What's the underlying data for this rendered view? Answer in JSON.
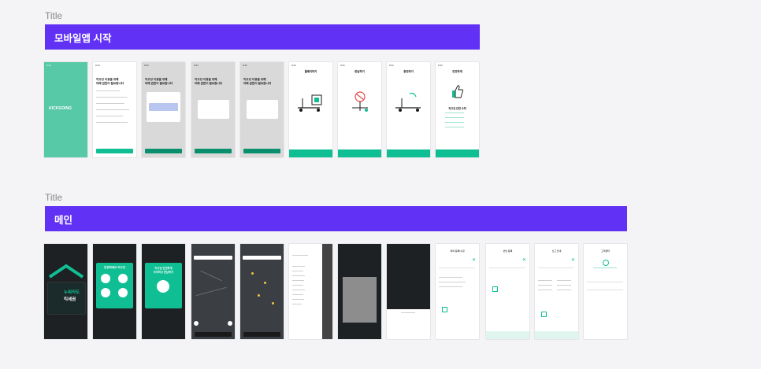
{
  "sections": [
    {
      "title": "Title",
      "banner": "모바일앱 시작"
    },
    {
      "title": "Title",
      "banner": "메인"
    }
  ],
  "splash": {
    "logo": "KICKGOING"
  },
  "permission": {
    "title": "킥고잉 이용을 위해\n아래 권한이 필요합니다"
  },
  "onboarding": [
    {
      "title": "플레이하기"
    },
    {
      "title": "반납하기"
    },
    {
      "title": "충전하기"
    },
    {
      "title": "안전하게"
    }
  ],
  "safety": {
    "title": "킥고잉 안전 수칙"
  },
  "main_cards": [
    {
      "line1": "누워라도",
      "line2": "킥세권"
    },
    {
      "line1": "안전하세요 킥고잉"
    },
    {
      "line1": "킥고잉 안전하게",
      "line2": "주차하고 반납하기"
    }
  ],
  "sheet_titles": [
    "대여 등록/수정",
    "반납 등록",
    "신고 안내",
    "고객센터"
  ],
  "colors": {
    "brand": "#6131f5",
    "accent": "#0fbf93",
    "bg": "#f4f4f6"
  }
}
